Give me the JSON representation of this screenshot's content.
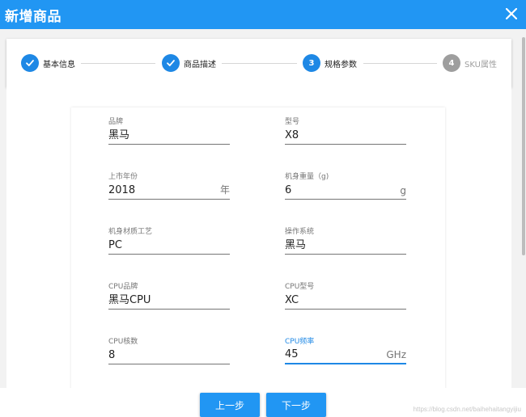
{
  "dialog": {
    "title": "新增商品"
  },
  "steps": [
    {
      "label": "基本信息",
      "state": "done"
    },
    {
      "label": "商品描述",
      "state": "done"
    },
    {
      "label": "规格参数",
      "state": "active",
      "number": "3"
    },
    {
      "label": "SKU属性",
      "state": "pending",
      "number": "4"
    }
  ],
  "form": {
    "brand": {
      "label": "品牌",
      "value": "黑马"
    },
    "model": {
      "label": "型号",
      "value": "X8"
    },
    "year": {
      "label": "上市年份",
      "value": "2018",
      "suffix": "年"
    },
    "weight": {
      "label": "机身重量（g)",
      "value": "6",
      "suffix": "g"
    },
    "material": {
      "label": "机身材质工艺",
      "value": "PC"
    },
    "os": {
      "label": "操作系统",
      "value": "黑马"
    },
    "cpu_brand": {
      "label": "CPU品牌",
      "value": "黑马CPU"
    },
    "cpu_model": {
      "label": "CPU型号",
      "value": "XC"
    },
    "cpu_cores": {
      "label": "CPU核数",
      "value": "8"
    },
    "cpu_freq": {
      "label": "CPU频率",
      "value": "45",
      "suffix": "GHz"
    }
  },
  "footer": {
    "prev_label": "上一步",
    "next_label": "下一步"
  },
  "watermark": "https://blog.csdn.net/baihehaitangyijiu",
  "colors": {
    "primary": "#2196f3",
    "step_active": "#1e88e5",
    "step_inactive": "#9e9e9e"
  }
}
